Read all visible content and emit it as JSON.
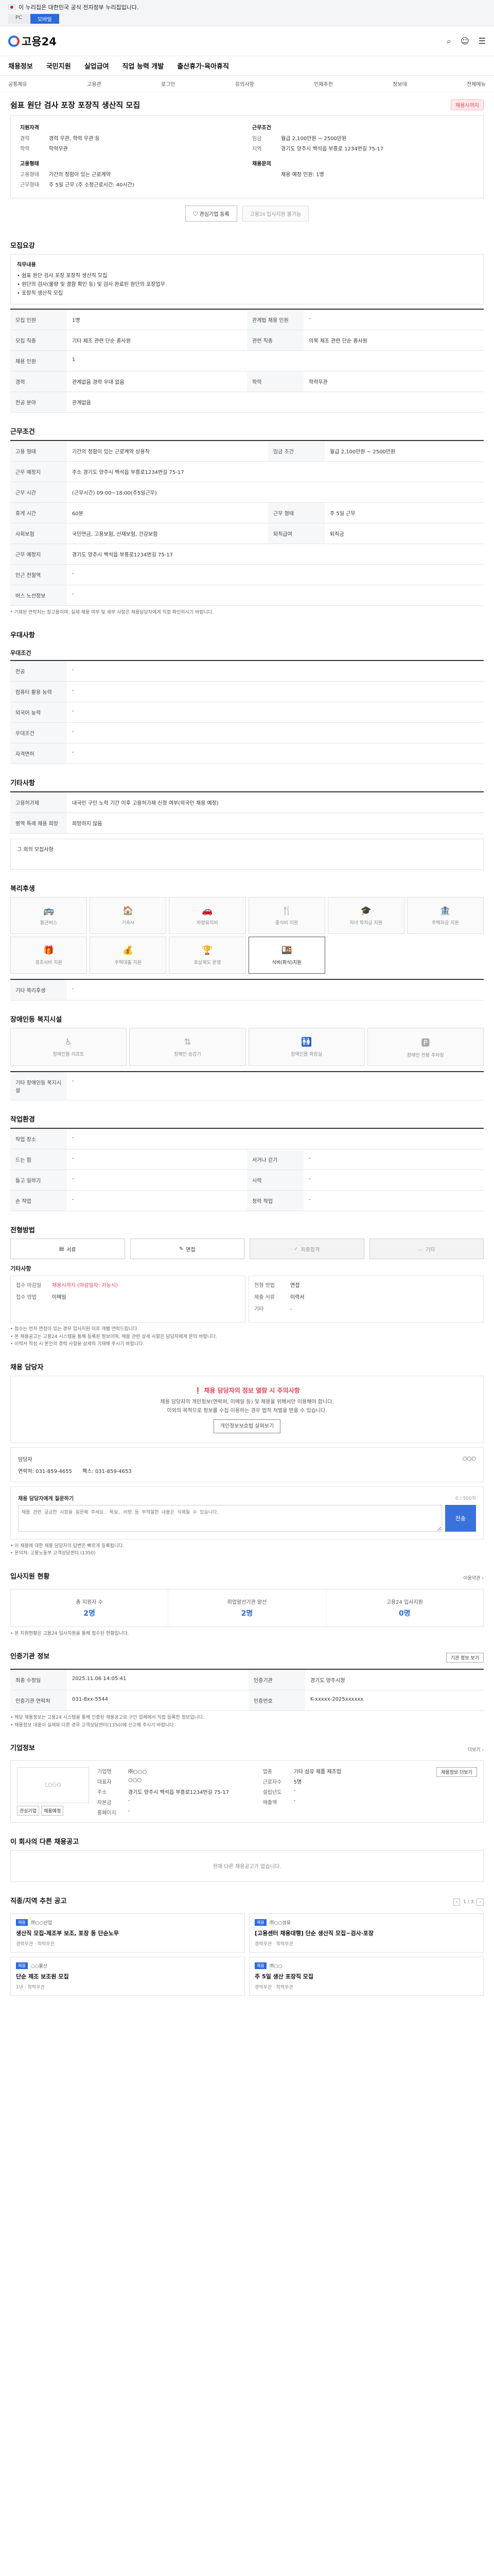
{
  "gov": {
    "text": "이 누리집은 대한민국 공식 전자정부 누리집입니다.",
    "tabs": [
      "PC",
      "모바일"
    ]
  },
  "header": {
    "logo": "고용24"
  },
  "gnb": [
    "채용정보",
    "국민지원",
    "실업급여",
    "직업 능력 개발",
    "출산휴가·육아휴직"
  ],
  "subnav": [
    "공통체유",
    "고용관",
    "로그인",
    "유의사항",
    "인재추천",
    "정보데",
    "전체메뉴"
  ],
  "job": {
    "title": "쉼표 원단 검사 포장 포장직 생산직 모집",
    "status": "채용시까지",
    "left": {
      "h1": "지원자격",
      "rows": [
        [
          "경력",
          "경력 무관, 학력 무관 등"
        ],
        [
          "학력",
          "학력무관"
        ]
      ],
      "h2": "고용형태",
      "rows2": [
        [
          "고용형태",
          "기간의 정함이 있는 근로계약"
        ],
        [
          "근무형태",
          "주 5일 근무 (주 소정근로시간: 40시간)"
        ]
      ]
    },
    "right": {
      "h1": "근무조건",
      "rows": [
        [
          "임금",
          "월급 2,100만원 ~ 2500만원"
        ],
        [
          "지역",
          "경기도 양주시 백석읍 부흥로 1234번길 75-17"
        ]
      ],
      "h2": "채용문의",
      "rows2": [
        [
          "",
          "채용 예정 인원: 1명"
        ]
      ]
    },
    "btn_interest": "관심기업 등록",
    "btn_apply": "고용24 입사지원 불가능"
  },
  "s_recruit": {
    "title": "모집요강",
    "box_h": "직무내용",
    "box_lines": [
      "• 쉼표 원단 검사 포장 포장직 생산직 모집",
      "• 원단의 검사(불량 및 결함 확인 등) 및 검사 완료된 원단의 포장업무",
      "• 포장직 생산직 모집"
    ],
    "rows": [
      [
        "모집 인원",
        "1명",
        "관계법 채용 인원",
        "-"
      ],
      [
        "모집 직종",
        "기타 제조 관련 단순 종사원",
        "관련 직종",
        "의복 제조 관련 단순 종사원"
      ],
      [
        "채용 인원",
        "1",
        "",
        ""
      ],
      [
        "경력",
        "관계없음 경력 우대 없음",
        "학력",
        "학력무관"
      ],
      [
        "전공 분야",
        "관계없음",
        "",
        ""
      ]
    ]
  },
  "s_cond": {
    "title": "근무조건",
    "rows": [
      [
        "고용 형태",
        "기간의 정함이 있는 근로계약  상용직",
        "임금 조건",
        "월급 2,100만원 ~ 2500만원"
      ],
      [
        "근무 예정지",
        "주소 경기도 양주시 백석읍 부흥로1234번길 75-17",
        "",
        ""
      ],
      [
        "근무 시간",
        "(근무시간) 09:00~18:00(주5일근무)",
        "",
        ""
      ],
      [
        "휴게 시간",
        "60분",
        "근무 형태",
        "주 5일 근무"
      ],
      [
        "사회보험",
        "국민연금, 고용보험, 산재보험, 건강보험",
        "퇴직급여",
        "퇴직금"
      ],
      [
        "근무 예정지",
        "경기도 양주시 백석읍 부흥로1234번길 75-17",
        "",
        ""
      ],
      [
        "인근 전철역",
        "-",
        "",
        ""
      ],
      [
        "버스 노선정보",
        "-",
        "",
        ""
      ]
    ],
    "note": "* 기재된 연락처는 참고용이며, 실제 채용 여부 및 세부 사항은 채용담당자에게 직접 확인하시기 바랍니다.",
    "map_btn": "지도 보기"
  },
  "s_pref": {
    "title": "우대사항",
    "h": "우대조건",
    "rows": [
      [
        "전공",
        "-"
      ],
      [
        "컴퓨터 활용 능력",
        "-"
      ],
      [
        "외국어 능력",
        "-"
      ],
      [
        "우대조건",
        "-"
      ],
      [
        "자격면허",
        "-"
      ]
    ]
  },
  "s_etc": {
    "title": "기타사항",
    "rows": [
      [
        "고용허가제",
        "내국인 구인 노력 기간 이후 고용허가제 신청 여부(외국인 채용 예정)"
      ],
      [
        "병역 특례 채용 희망",
        "희망하지 않음"
      ]
    ],
    "box": "그 외의 모집사항"
  },
  "s_welfare": {
    "title": "복리후생",
    "items": [
      [
        "통근버스",
        "🚌"
      ],
      [
        "기숙사",
        "🏠"
      ],
      [
        "차량유지비",
        "🚗"
      ],
      [
        "중식비 지원",
        "🍴"
      ],
      [
        "자녀 학자금 지원",
        "🎓"
      ],
      [
        "주택자금 지원",
        "🏦"
      ],
      [
        "경조사비 지원",
        "🎁"
      ],
      [
        "주택대출 지원",
        "💰"
      ],
      [
        "포상제도 운영",
        "🏆"
      ],
      [
        "식비(회식)지원",
        "🍱"
      ]
    ],
    "on_index": 9,
    "etc_title": "기타 복리후생",
    "etc_value": "-"
  },
  "s_disab": {
    "title": "장애인등 복지시설",
    "items": [
      "장애인용 리프트",
      "장애인 승강기",
      "장애인용 화장실",
      "장애인 전용 주차장"
    ],
    "etc_title": "기타 장애인등 복지시설",
    "etc_value": "-"
  },
  "s_env": {
    "title": "작업환경",
    "rows": [
      [
        "작업 장소",
        "-",
        "",
        ""
      ],
      [
        "드는 힘",
        "-",
        "서거나 걷기",
        "-"
      ],
      [
        "들고 일하기",
        "-",
        "시력",
        "-"
      ],
      [
        "손 작업",
        "-",
        "청력 작업",
        "-"
      ]
    ]
  },
  "s_process": {
    "title": "전형방법",
    "steps": [
      "서류",
      "면접",
      "최종합격",
      "기타"
    ],
    "sub": "기타사항",
    "left": [
      [
        "접수 마감일",
        "채용시까지 (마감일자: 가능시)"
      ],
      [
        "접수 방법",
        "이메일"
      ]
    ],
    "right": [
      [
        "전형 방법",
        "면접"
      ],
      [
        "제출 서류",
        "이력서"
      ],
      [
        "기타",
        "-"
      ]
    ],
    "notes": [
      "• 접수는 먼저 면접이 있는 경우 입사지원 이후 개별 연락드립니다.",
      "• 본 채용공고는 고용24 시스템을 통해 등록된 정보이며, 채용 관련 상세 사항은 담당자에게 문의 바랍니다.",
      "• 이력서 작성 시 본인의 경력 사항을 상세히 기재해 주시기 바랍니다."
    ]
  },
  "s_contact": {
    "title": "채용 담당자",
    "warn": "채용 담당자의 정보 열람 시 주의사항",
    "warn_body": "채용 담당자의 개인정보(연락처, 이메일 등) 및 채용을 위해서만 이용해야 합니다.",
    "warn_body2": "이외의 목적으로 정보를 수집·이용하는 경우 법적 처벌을 받을 수 있습니다.",
    "warn_btn": "개인정보보호법 살펴보기",
    "name_k": "담당자",
    "name_v": "○○○",
    "tel": "연락처: 031-859-4655",
    "fax": "팩스: 031-859-4653",
    "cmt_title": "채용 담당자에게 질문하기",
    "cmt_ph": "채용 관련 궁금한 사항을 질문해 주세요. 욕설, 비방 등 부적절한 내용은 삭제될 수 있습니다.",
    "cmt_btn": "전송",
    "cmt_count": "0 / 500자",
    "notes": [
      "• 이 채용에 대한 채용 담당자의 답변은 빠르게 등록됩니다.",
      "• 문의처: 고용노동부 고객상담센터 (1350)"
    ]
  },
  "s_apply": {
    "title": "입사지원 현황",
    "more": "이용약관 ›",
    "stats": [
      [
        "총 지원자 수",
        "2명"
      ],
      [
        "취업알선기관 알선",
        "2명"
      ],
      [
        "고용24 입사지원",
        "0명"
      ]
    ],
    "note": "• 본 지원현황은 고용24 입사지원을 통해 접수된 현황입니다."
  },
  "s_info": {
    "title": "인증기관 정보",
    "btn": "기관 정보 보기",
    "rows": [
      [
        "최종 수정일",
        "2025.11.06 14:05:41",
        "인증기관",
        "경기도 양주시청"
      ],
      [
        "인증기관 연락처",
        "031-8xx-5544",
        "인증번호",
        "K-xxxxx-2025xxxxxx"
      ]
    ],
    "notes": [
      "• 해당 채용정보는 고용24 시스템을 통해 인증된 채용공고로 구인 업체에서 직접 등록한 정보입니다.",
      "• 채용정보 내용이 실제와 다른 경우 고객상담센터(1350)에 신고해 주시기 바랍니다."
    ]
  },
  "s_org": {
    "title": "기업정보",
    "more": "더보기 ›",
    "logo": "LOGO",
    "btns": [
      "관심기업",
      "채용예정"
    ],
    "rows": [
      [
        "기업명",
        "㈜○○○",
        "업종",
        "기타 섬유 제품 제조업"
      ],
      [
        "대표자",
        "○○○",
        "근로자수",
        "5명"
      ],
      [
        "주소",
        "경기도 양주시 백석읍 부흥로1234번길 75-17",
        "설립년도",
        "-"
      ],
      [
        "자본금",
        "-",
        "매출액",
        "-"
      ],
      [
        "홈페이지",
        "-",
        "",
        ""
      ]
    ],
    "right_btn": "채용정보 더보기"
  },
  "s_other": {
    "title": "이 회사의 다른 채용공고",
    "empty": "현재 다른 채용공고가 없습니다."
  },
  "s_recommend": {
    "title": "직종/지역 추천 공고",
    "pager": "1 / 3",
    "cards": [
      {
        "co": "㈜○○산업",
        "tt": "생산직 모집-제조부 보조, 포장 등 단순노무",
        "m1": "경력무관",
        "m2": "학력무관"
      },
      {
        "co": "㈜○○섬유",
        "tt": "[고용센터 채용대행] 단순 생산직 모집~검사·포장",
        "m1": "경력무관",
        "m2": "학력무관"
      },
      {
        "co": "○○물산",
        "tt": "단순 제조 보조원 모집",
        "m1": "1년",
        "m2": "학력무관"
      },
      {
        "co": "㈜○○",
        "tt": "주 5일 생산 포장직 모집",
        "m1": "경력무관",
        "m2": "학력무관"
      }
    ]
  }
}
